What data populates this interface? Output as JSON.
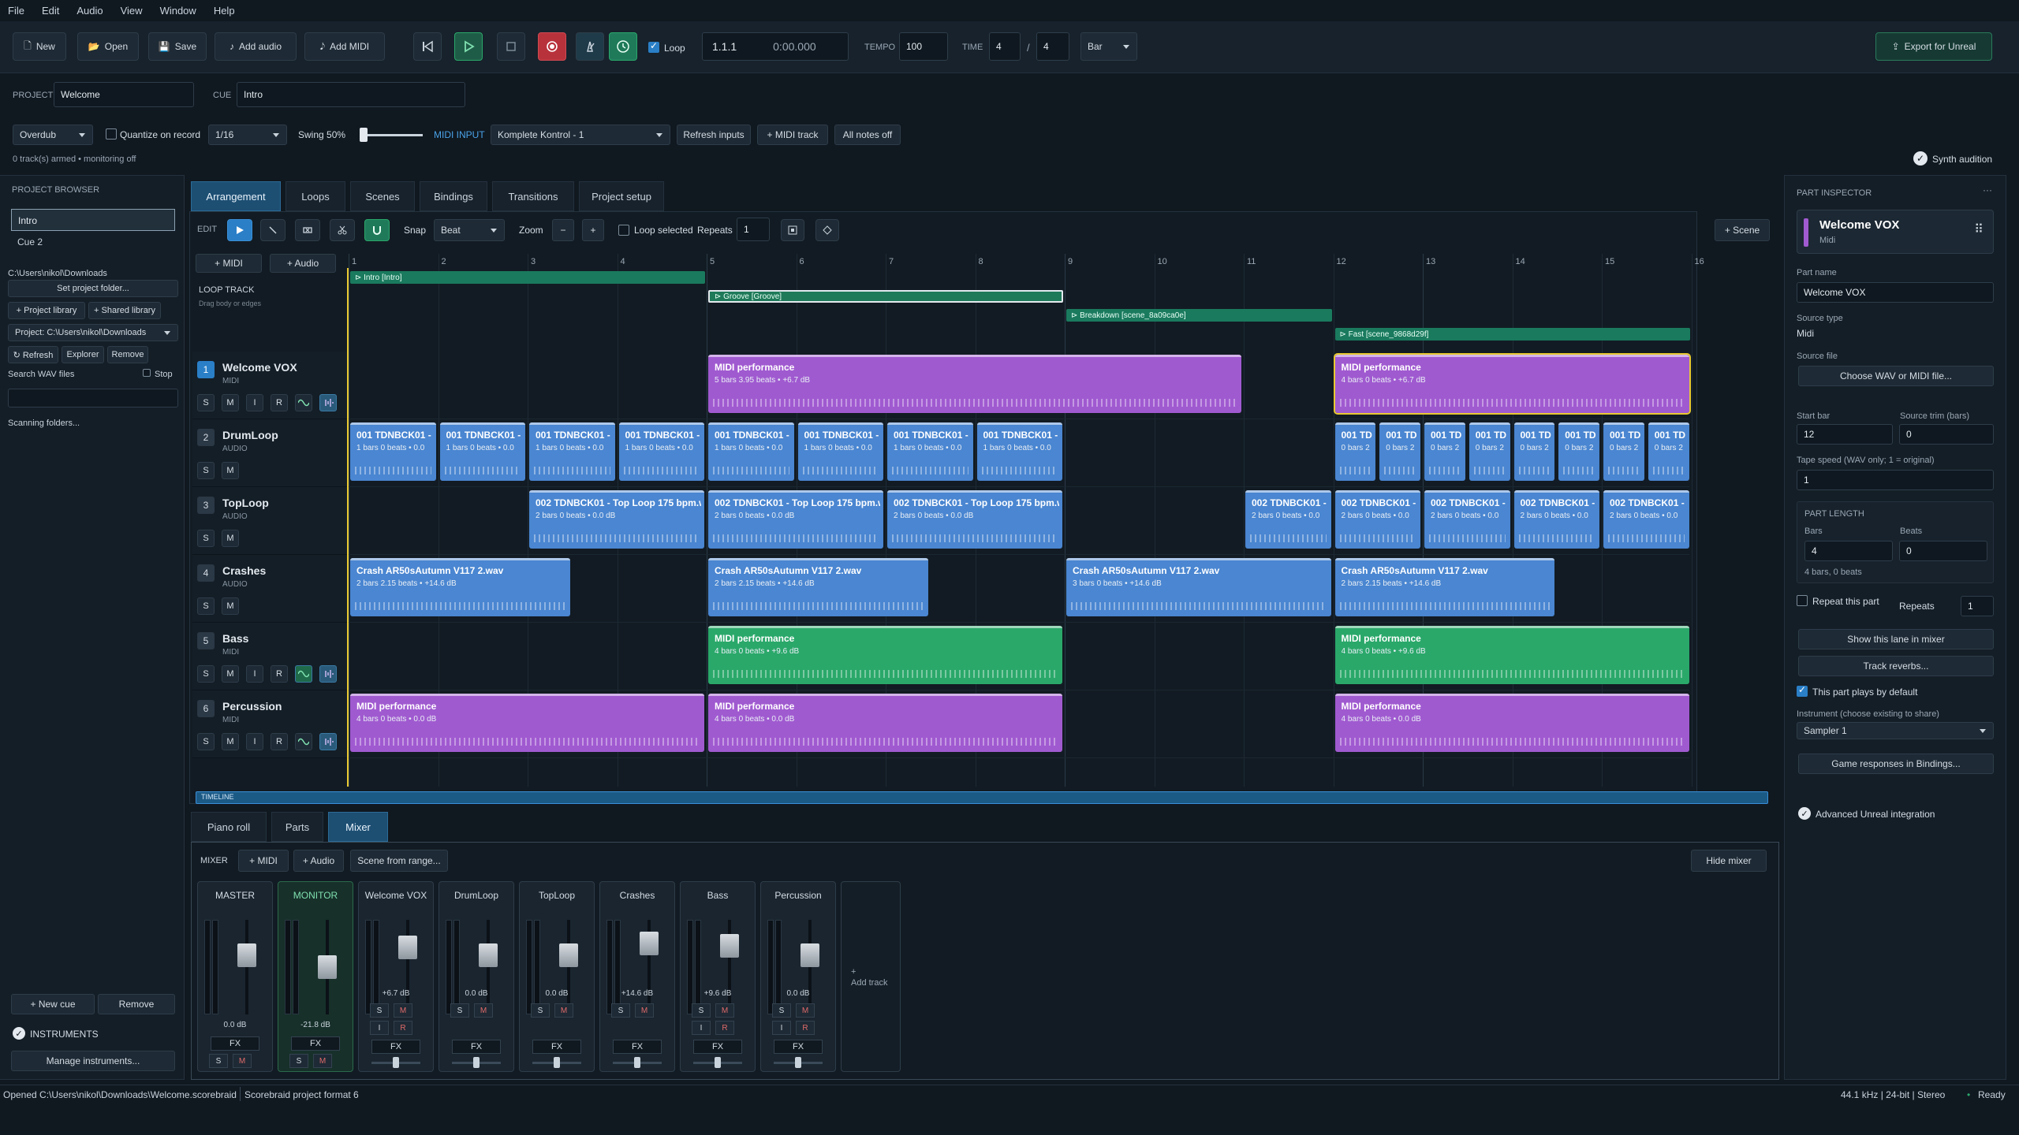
{
  "menu": [
    "File",
    "Edit",
    "Audio",
    "View",
    "Window",
    "Help"
  ],
  "toolbar": {
    "new": "New",
    "open": "Open",
    "save": "Save",
    "add_audio": "Add audio",
    "add_midi": "Add MIDI",
    "loop": "Loop",
    "position_bars": "1.1.1",
    "position_time": "0:00.000",
    "tempo_label": "TEMPO",
    "tempo": "100",
    "time_label": "TIME",
    "sig_num": "4",
    "sig_sep": "/",
    "sig_den": "4",
    "grid": "Bar",
    "export": "Export for Unreal"
  },
  "project": {
    "project_label": "PROJECT",
    "project_name": "Welcome",
    "cue_label": "CUE",
    "cue_name": "Intro"
  },
  "record": {
    "mode": "Overdub",
    "quantize": "Quantize on record",
    "quant_value": "1/16",
    "swing": "Swing 50%",
    "midi_input_label": "MIDI INPUT",
    "midi_input": "Komplete Kontrol - 1",
    "refresh_inputs": "Refresh inputs",
    "midi_track": "+ MIDI track",
    "all_notes_off": "All notes off",
    "armed_status": "0 track(s) armed • monitoring off",
    "synth_audition": "Synth audition"
  },
  "browser": {
    "title": "PROJECT BROWSER",
    "cues": [
      "Intro",
      "Cue 2"
    ],
    "path": "C:\\Users\\nikol\\Downloads",
    "set_folder": "Set project folder...",
    "project_library": "+ Project library",
    "shared_library": "+ Shared library",
    "project_path": "Project: C:\\Users\\nikol\\Downloads",
    "refresh": "↻ Refresh",
    "explorer": "Explorer",
    "remove": "Remove",
    "search_wav": "Search WAV files",
    "stop": "Stop",
    "scanning": "Scanning folders...",
    "new_cue": "+ New cue",
    "remove_cue": "Remove",
    "instruments": "INSTRUMENTS",
    "manage_instruments": "Manage instruments..."
  },
  "tabs": [
    "Arrangement",
    "Loops",
    "Scenes",
    "Bindings",
    "Transitions",
    "Project setup"
  ],
  "edit": {
    "edit_label": "EDIT",
    "snap_label": "Snap",
    "snap": "Beat",
    "zoom_label": "Zoom",
    "zoom_out": "−",
    "zoom_in": "+",
    "loop_selected": "Loop selected",
    "repeats_label": "Repeats",
    "repeats": "1",
    "scene": "+ Scene"
  },
  "arr": {
    "add_midi": "+ MIDI",
    "add_audio": "+ Audio",
    "loop_track": "LOOP TRACK",
    "drag_hint": "Drag body or edges",
    "timeline": "TIMELINE"
  },
  "ruler": [
    "1",
    "2",
    "3",
    "4",
    "5",
    "6",
    "7",
    "8",
    "9",
    "10",
    "11",
    "12",
    "13",
    "14",
    "15",
    "16"
  ],
  "loops": [
    {
      "label": "⊳ Intro  [Intro]",
      "bar": 1,
      "len": 4,
      "row": 0
    },
    {
      "label": "⊳ Groove  [Groove]",
      "bar": 5,
      "len": 4,
      "row": 1
    },
    {
      "label": "⊳ Breakdown  [scene_8a09ca0e]",
      "bar": 9,
      "len": 3,
      "row": 2
    },
    {
      "label": "⊳ Fast  [scene_9868d29f]",
      "bar": 12,
      "len": 4,
      "row": 3
    }
  ],
  "tracks": [
    {
      "num": "1",
      "name": "Welcome VOX",
      "type": "MIDI",
      "btns": [
        "S",
        "M",
        "I",
        "R"
      ],
      "selected": true
    },
    {
      "num": "2",
      "name": "DrumLoop",
      "type": "AUDIO",
      "btns": [
        "S",
        "M"
      ]
    },
    {
      "num": "3",
      "name": "TopLoop",
      "type": "AUDIO",
      "btns": [
        "S",
        "M"
      ]
    },
    {
      "num": "4",
      "name": "Crashes",
      "type": "AUDIO",
      "btns": [
        "S",
        "M"
      ]
    },
    {
      "num": "5",
      "name": "Bass",
      "type": "MIDI",
      "btns": [
        "S",
        "M",
        "I",
        "R"
      ]
    },
    {
      "num": "6",
      "name": "Percussion",
      "type": "MIDI",
      "btns": [
        "S",
        "M",
        "I",
        "R"
      ]
    }
  ],
  "clips": [
    {
      "track": 0,
      "bar": 5,
      "len": 6,
      "kind": "midi-p",
      "title": "MIDI performance",
      "sub": "5 bars 3.95 beats  •  +6.7 dB"
    },
    {
      "track": 0,
      "bar": 12,
      "len": 4,
      "kind": "midi-p",
      "title": "MIDI performance",
      "sub": "4 bars 0 beats  •  +6.7 dB",
      "sel": true
    },
    {
      "track": 1,
      "bar": 1,
      "len": 1,
      "kind": "audio",
      "title": "001 TDNBCK01 -",
      "sub": "1 bars 0 beats  •  0.0"
    },
    {
      "track": 1,
      "bar": 2,
      "len": 1,
      "kind": "audio",
      "title": "001 TDNBCK01 -",
      "sub": "1 bars 0 beats  •  0.0"
    },
    {
      "track": 1,
      "bar": 3,
      "len": 1,
      "kind": "audio",
      "title": "001 TDNBCK01 -",
      "sub": "1 bars 0 beats  •  0.0"
    },
    {
      "track": 1,
      "bar": 4,
      "len": 1,
      "kind": "audio",
      "title": "001 TDNBCK01 -",
      "sub": "1 bars 0 beats  •  0.0"
    },
    {
      "track": 1,
      "bar": 5,
      "len": 1,
      "kind": "audio",
      "title": "001 TDNBCK01 -",
      "sub": "1 bars 0 beats  •  0.0"
    },
    {
      "track": 1,
      "bar": 6,
      "len": 1,
      "kind": "audio",
      "title": "001 TDNBCK01 -",
      "sub": "1 bars 0 beats  •  0.0"
    },
    {
      "track": 1,
      "bar": 7,
      "len": 1,
      "kind": "audio",
      "title": "001 TDNBCK01 -",
      "sub": "1 bars 0 beats  •  0.0"
    },
    {
      "track": 1,
      "bar": 8,
      "len": 1,
      "kind": "audio",
      "title": "001 TDNBCK01 -",
      "sub": "1 bars 0 beats  •  0.0"
    },
    {
      "track": 1,
      "bar": 12,
      "len": 0.5,
      "kind": "audio",
      "title": "001 TD",
      "sub": "0 bars 2"
    },
    {
      "track": 1,
      "bar": 12.5,
      "len": 0.5,
      "kind": "audio",
      "title": "001 TD",
      "sub": "0 bars 2"
    },
    {
      "track": 1,
      "bar": 13,
      "len": 0.5,
      "kind": "audio",
      "title": "001 TD",
      "sub": "0 bars 2"
    },
    {
      "track": 1,
      "bar": 13.5,
      "len": 0.5,
      "kind": "audio",
      "title": "001 TD",
      "sub": "0 bars 2"
    },
    {
      "track": 1,
      "bar": 14,
      "len": 0.5,
      "kind": "audio",
      "title": "001 TD",
      "sub": "0 bars 2"
    },
    {
      "track": 1,
      "bar": 14.5,
      "len": 0.5,
      "kind": "audio",
      "title": "001 TD",
      "sub": "0 bars 2"
    },
    {
      "track": 1,
      "bar": 15,
      "len": 0.5,
      "kind": "audio",
      "title": "001 TD",
      "sub": "0 bars 2"
    },
    {
      "track": 1,
      "bar": 15.5,
      "len": 0.5,
      "kind": "audio",
      "title": "001 TD",
      "sub": "0 bars 2"
    },
    {
      "track": 2,
      "bar": 3,
      "len": 2,
      "kind": "audio",
      "title": "002 TDNBCK01 - Top Loop 175 bpm.w",
      "sub": "2 bars 0 beats  •  0.0 dB"
    },
    {
      "track": 2,
      "bar": 5,
      "len": 2,
      "kind": "audio",
      "title": "002 TDNBCK01 - Top Loop 175 bpm.w",
      "sub": "2 bars 0 beats  •  0.0 dB"
    },
    {
      "track": 2,
      "bar": 7,
      "len": 2,
      "kind": "audio",
      "title": "002 TDNBCK01 - Top Loop 175 bpm.w",
      "sub": "2 bars 0 beats  •  0.0 dB"
    },
    {
      "track": 2,
      "bar": 11,
      "len": 1,
      "kind": "audio",
      "title": "002 TDNBCK01 -",
      "sub": "2 bars 0 beats  •  0.0"
    },
    {
      "track": 2,
      "bar": 12,
      "len": 1,
      "kind": "audio",
      "title": "002 TDNBCK01 -",
      "sub": "2 bars 0 beats  •  0.0"
    },
    {
      "track": 2,
      "bar": 13,
      "len": 1,
      "kind": "audio",
      "title": "002 TDNBCK01 -",
      "sub": "2 bars 0 beats  •  0.0"
    },
    {
      "track": 2,
      "bar": 14,
      "len": 1,
      "kind": "audio",
      "title": "002 TDNBCK01 -",
      "sub": "2 bars 0 beats  •  0.0"
    },
    {
      "track": 2,
      "bar": 15,
      "len": 1,
      "kind": "audio",
      "title": "002 TDNBCK01 -",
      "sub": "2 bars 0 beats  •  0.0"
    },
    {
      "track": 3,
      "bar": 1,
      "len": 2.5,
      "kind": "audio",
      "title": "Crash AR50sAutumn V117 2.wav",
      "sub": "2 bars 2.15 beats  •  +14.6 dB"
    },
    {
      "track": 3,
      "bar": 5,
      "len": 2.5,
      "kind": "audio",
      "title": "Crash AR50sAutumn V117 2.wav",
      "sub": "2 bars 2.15 beats  •  +14.6 dB"
    },
    {
      "track": 3,
      "bar": 9,
      "len": 3,
      "kind": "audio",
      "title": "Crash AR50sAutumn V117 2.wav",
      "sub": "3 bars 0 beats  •  +14.6 dB"
    },
    {
      "track": 3,
      "bar": 12,
      "len": 2.5,
      "kind": "audio",
      "title": "Crash AR50sAutumn V117 2.wav",
      "sub": "2 bars 2.15 beats  •  +14.6 dB"
    },
    {
      "track": 4,
      "bar": 5,
      "len": 4,
      "kind": "midi-g",
      "title": "MIDI performance",
      "sub": "4 bars 0 beats  •  +9.6 dB"
    },
    {
      "track": 4,
      "bar": 12,
      "len": 4,
      "kind": "midi-g",
      "title": "MIDI performance",
      "sub": "4 bars 0 beats  •  +9.6 dB"
    },
    {
      "track": 5,
      "bar": 1,
      "len": 4,
      "kind": "midi-p",
      "title": "MIDI performance",
      "sub": "4 bars 0 beats  •  0.0 dB"
    },
    {
      "track": 5,
      "bar": 5,
      "len": 4,
      "kind": "midi-p",
      "title": "MIDI performance",
      "sub": "4 bars 0 beats  •  0.0 dB"
    },
    {
      "track": 5,
      "bar": 12,
      "len": 4,
      "kind": "midi-p",
      "title": "MIDI performance",
      "sub": "4 bars 0 beats  •  0.0 dB"
    }
  ],
  "bottom_tabs": [
    "Piano roll",
    "Parts",
    "Mixer"
  ],
  "mixer": {
    "label": "MIXER",
    "add_midi": "+ MIDI",
    "add_audio": "+ Audio",
    "scene_from_range": "Scene from range...",
    "hide": "Hide mixer",
    "add_track": "Add track",
    "fx": "FX",
    "strips": [
      {
        "name": "MASTER",
        "db": "0.0 dB",
        "level": 0.7
      },
      {
        "name": "MONITOR",
        "db": "-21.8 dB",
        "level": 0.55
      },
      {
        "name": "Welcome VOX",
        "db": "+6.7 dB",
        "level": 0.8
      },
      {
        "name": "DrumLoop",
        "db": "0.0 dB",
        "level": 0.7
      },
      {
        "name": "TopLoop",
        "db": "0.0 dB",
        "level": 0.7
      },
      {
        "name": "Crashes",
        "db": "+14.6 dB",
        "level": 0.85
      },
      {
        "name": "Bass",
        "db": "+9.6 dB",
        "level": 0.82
      },
      {
        "name": "Percussion",
        "db": "0.0 dB",
        "level": 0.7
      }
    ]
  },
  "inspector": {
    "title": "PART INSPECTOR",
    "part": "Welcome VOX",
    "part_type": "Midi",
    "part_name_label": "Part name",
    "part_name": "Welcome VOX",
    "source_type_label": "Source type",
    "source_type": "Midi",
    "source_file_label": "Source file",
    "choose_file": "Choose WAV or MIDI file...",
    "start_bar_label": "Start bar",
    "start_bar": "12",
    "trim_label": "Source trim (bars)",
    "trim": "0",
    "tape_label": "Tape speed (WAV only; 1 = original)",
    "tape": "1",
    "part_length": "PART LENGTH",
    "bars_label": "Bars",
    "bars": "4",
    "beats_label": "Beats",
    "beats": "0",
    "length_summary": "4 bars, 0 beats",
    "repeat_label": "Repeat this part",
    "repeats_label": "Repeats",
    "repeats": "1",
    "show_mixer": "Show this lane in mixer",
    "track_reverbs": "Track reverbs...",
    "plays_default": "This part plays by default",
    "instrument_label": "Instrument (choose existing to share)",
    "instrument": "Sampler 1",
    "game_responses": "Game responses in Bindings...",
    "advanced": "Advanced Unreal integration"
  },
  "status": {
    "opened": "Opened C:\\Users\\nikol\\Downloads\\Welcome.scorebraid",
    "format": "Scorebraid project format 6",
    "audio": "44.1 kHz | 24-bit | Stereo",
    "ready": "Ready"
  },
  "colors": {
    "accent": "#2a7fc7",
    "midi_purple": "#a05ad0",
    "midi_green": "#2aa86a",
    "audio_blue": "#4a86d1",
    "record": "#c8323c",
    "play": "#2aa86a"
  }
}
